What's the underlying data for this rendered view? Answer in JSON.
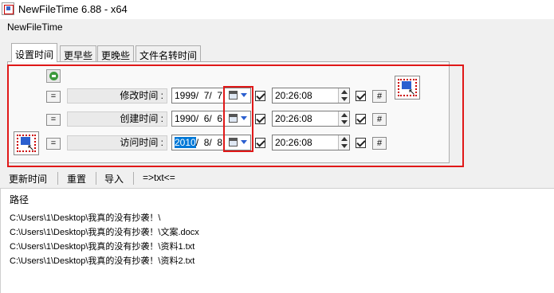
{
  "window": {
    "title": "NewFileTime 6.88 - x64"
  },
  "menu": {
    "items": [
      "NewFileTime"
    ]
  },
  "tabs": [
    {
      "label": "设置时间",
      "active": true
    },
    {
      "label": "更早些",
      "active": false
    },
    {
      "label": "更晚些",
      "active": false
    },
    {
      "label": "文件名转时间",
      "active": false
    }
  ],
  "rows": [
    {
      "eq_label": "=",
      "label": "修改时间 :",
      "date": "1999/  7/  7",
      "date_selected": "",
      "date_rest": "",
      "time": "20:26:08",
      "checked": true,
      "hash_label": "#"
    },
    {
      "eq_label": "=",
      "label": "创建时间 :",
      "date": "1990/  6/  6",
      "date_selected": "",
      "date_rest": "",
      "time": "20:26:08",
      "checked": true,
      "hash_label": "#"
    },
    {
      "eq_label": "=",
      "label": "访问时间 :",
      "date": "",
      "date_selected": "2010",
      "date_rest": "/  8/  8",
      "time": "20:26:08",
      "checked": true,
      "hash_label": "#"
    }
  ],
  "toolbar": {
    "update_time": "更新时间",
    "reset": "重置",
    "import": "导入",
    "txt_convert": "=>txt<="
  },
  "content": {
    "header": "路径",
    "paths": [
      "C:\\Users\\1\\Desktop\\我真的没有抄袭！\\",
      "C:\\Users\\1\\Desktop\\我真的没有抄袭！\\文案.docx",
      "C:\\Users\\1\\Desktop\\我真的没有抄袭！\\资料1.txt",
      "C:\\Users\\1\\Desktop\\我真的没有抄袭！\\资料2.txt"
    ]
  },
  "icons": {
    "app": "app-icon",
    "refresh": "refresh-icon",
    "drag_target": "drag-target-icon",
    "calendar": "calendar-icon",
    "spin": "spin-updown-icon"
  },
  "colors": {
    "highlight_red": "#e01818",
    "selection_blue": "#0078d7",
    "background": "#f0f0f0"
  }
}
